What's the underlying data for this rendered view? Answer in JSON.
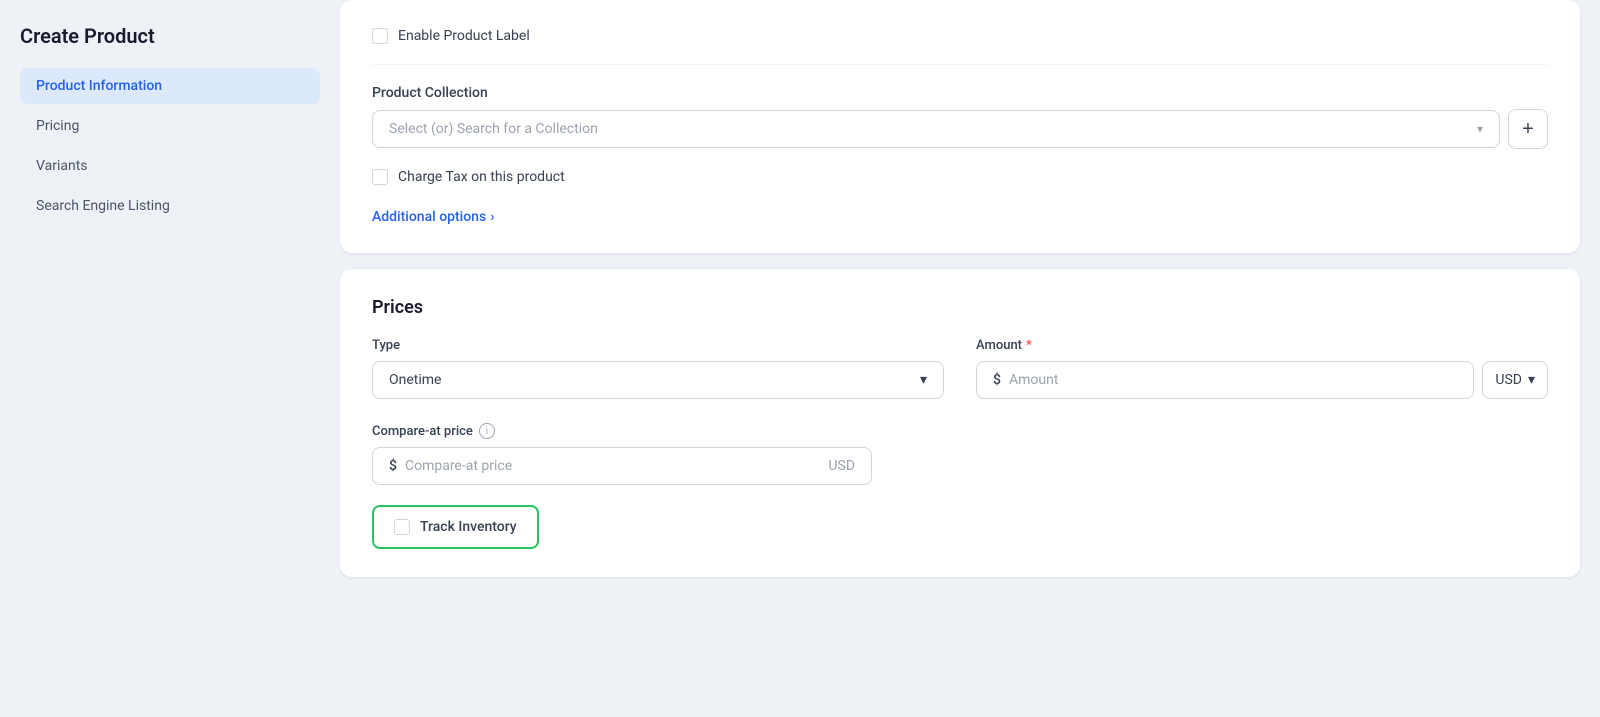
{
  "app": {
    "title": "Create Product"
  },
  "sidebar": {
    "items": [
      {
        "id": "product-information",
        "label": "Product Information",
        "active": true
      },
      {
        "id": "pricing",
        "label": "Pricing",
        "active": false
      },
      {
        "id": "variants",
        "label": "Variants",
        "active": false
      },
      {
        "id": "search-engine-listing",
        "label": "Search Engine Listing",
        "active": false
      }
    ]
  },
  "product_section": {
    "enable_product_label": "Enable Product Label",
    "product_collection_label": "Product Collection",
    "collection_placeholder": "Select (or) Search for a Collection",
    "charge_tax_label": "Charge Tax on this product",
    "additional_options_label": "Additional options",
    "additional_options_chevron": "›"
  },
  "prices_section": {
    "title": "Prices",
    "type_label": "Type",
    "type_value": "Onetime",
    "amount_label": "Amount",
    "amount_placeholder": "Amount",
    "currency_value": "USD",
    "compare_label": "Compare-at price",
    "compare_placeholder": "Compare-at price",
    "compare_currency": "USD",
    "info_icon": "i",
    "dollar_sign": "$",
    "chevron_down": "▾"
  },
  "track_inventory": {
    "label": "Track Inventory"
  },
  "colors": {
    "active_nav_bg": "#dce8fb",
    "active_nav_text": "#2563eb",
    "link_color": "#2563eb",
    "required_color": "#ef4444",
    "track_border": "#22c55e"
  }
}
